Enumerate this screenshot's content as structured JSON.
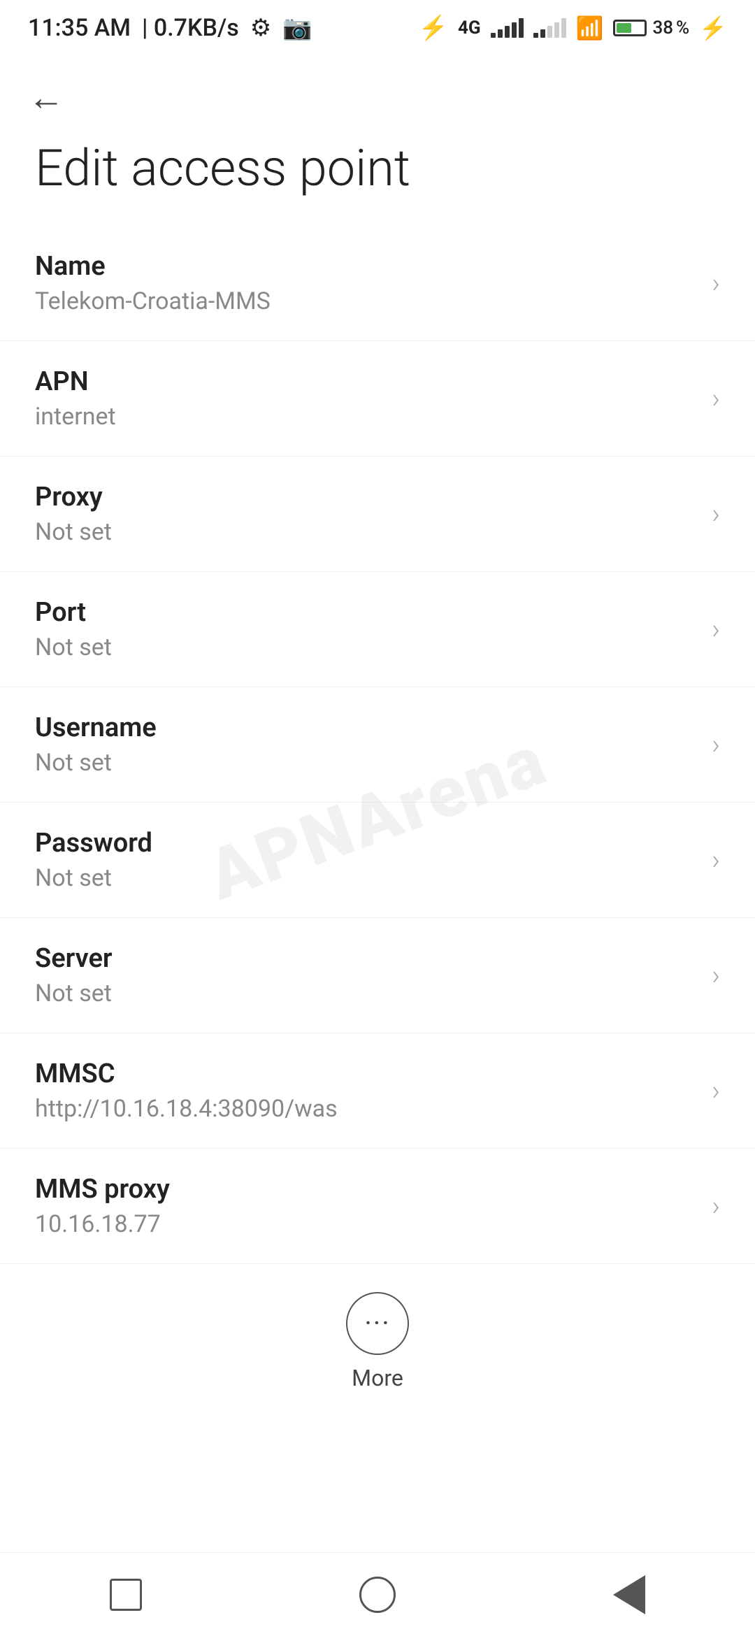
{
  "statusBar": {
    "time": "11:35 AM",
    "speed": "0.7KB/s",
    "battery": "38"
  },
  "toolbar": {
    "backLabel": "←"
  },
  "page": {
    "title": "Edit access point"
  },
  "settings": {
    "items": [
      {
        "label": "Name",
        "value": "Telekom-Croatia-MMS"
      },
      {
        "label": "APN",
        "value": "internet"
      },
      {
        "label": "Proxy",
        "value": "Not set"
      },
      {
        "label": "Port",
        "value": "Not set"
      },
      {
        "label": "Username",
        "value": "Not set"
      },
      {
        "label": "Password",
        "value": "Not set"
      },
      {
        "label": "Server",
        "value": "Not set"
      },
      {
        "label": "MMSC",
        "value": "http://10.16.18.4:38090/was"
      },
      {
        "label": "MMS proxy",
        "value": "10.16.18.77"
      }
    ]
  },
  "more": {
    "label": "More"
  },
  "watermark": "APNArena",
  "navigation": {
    "square": "recent-apps",
    "circle": "home",
    "triangle": "back"
  }
}
